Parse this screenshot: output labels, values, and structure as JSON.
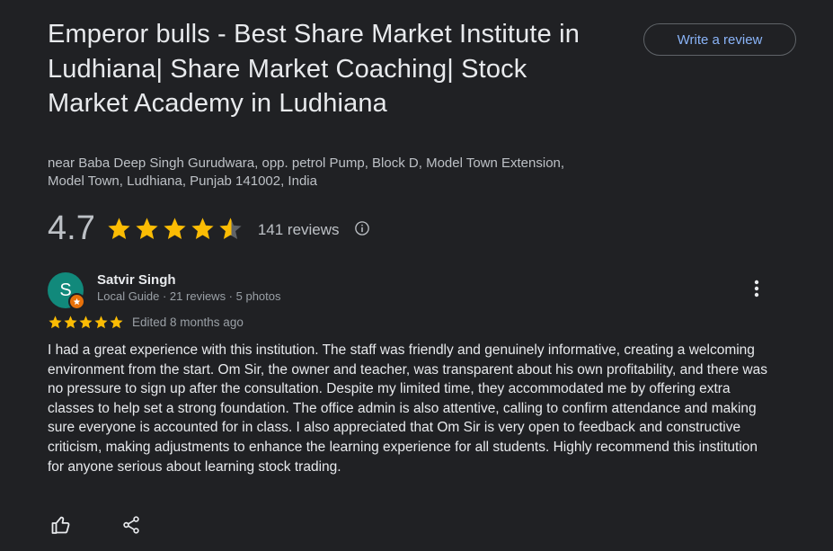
{
  "place": {
    "title": "Emperor bulls - Best Share Market Institute in Ludhiana| Share Market Coaching| Stock Market Academy in Ludhiana",
    "address": "near Baba Deep Singh Gurudwara, opp. petrol Pump, Block D, Model Town Extension, Model Town, Ludhiana, Punjab 141002, India",
    "write_review_label": "Write a review"
  },
  "rating": {
    "value": "4.7",
    "stars": 4.7,
    "reviews_count_label": "141 reviews",
    "info_icon": "info-icon"
  },
  "review": {
    "avatar_letter": "S",
    "avatar_color": "#11897b",
    "badge_color": "#e8710a",
    "reviewer_name": "Satvir Singh",
    "reviewer_meta": "Local Guide · 21 reviews · 5 photos",
    "stars": 5,
    "edited_label": "Edited 8 months ago",
    "text": "I had a great experience with this institution. The staff was friendly and genuinely informative, creating a welcoming environment from the start. Om Sir, the owner and teacher, was transparent about his own profitability, and there was no pressure to sign up after the consultation. Despite my limited time, they accommodated me by offering extra classes to help set a strong foundation. The office admin is also attentive, calling to confirm attendance and making sure everyone is accounted for in class. I also appreciated that Om Sir is very open to feedback and constructive criticism, making adjustments to enhance the learning experience for all students. Highly recommend this institution for anyone serious about learning stock trading.",
    "more_icon": "more-vert-icon",
    "like_icon": "thumbs-up-icon",
    "share_icon": "share-icon"
  },
  "colors": {
    "background": "#202124",
    "star": "#fbbc04",
    "star_empty": "#5f6368",
    "link": "#8ab4f8"
  }
}
